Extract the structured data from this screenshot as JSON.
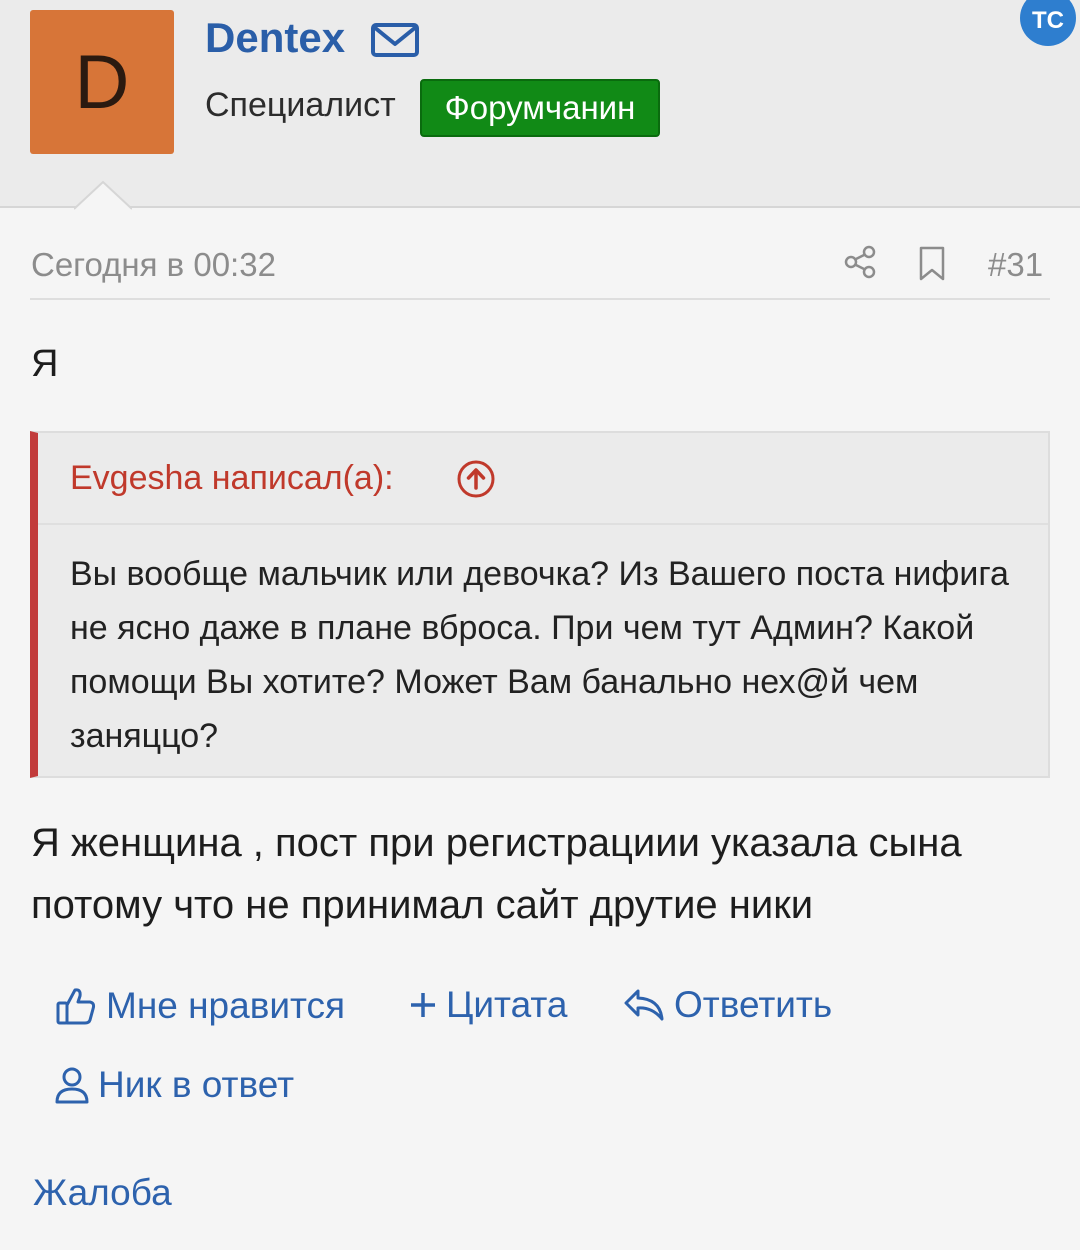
{
  "header": {
    "avatar_letter": "D",
    "username": "Dentex",
    "user_title": "Специалист",
    "badge": "Форумчанин",
    "tc_badge": "ТС",
    "avatar_color": "#d77538",
    "badge_color": "#118a16"
  },
  "meta": {
    "date": "Сегодня в 00:32",
    "post_number": "#31"
  },
  "post": {
    "first_line": "Я",
    "quote": {
      "author": "Evgesha написал(а):",
      "text": "Вы вообще мальчик или девочка? Из Вашего поста нифига не ясно даже в плане вброса. При чем тут Админ? Какой помощи Вы хотите? Может Вам банально нех@й чем заняццо?"
    },
    "reply": "Я женщина , пост при регистрациии указала сына потому что не принимал сайт друтие ники"
  },
  "actions": {
    "like": "Мне нравится",
    "quote": "Цитата",
    "reply": "Ответить",
    "nick": "Ник в ответ",
    "report": "Жалоба"
  },
  "colors": {
    "link": "#2d62ad",
    "quote_border": "#c23b3b",
    "quote_author": "#c0392b"
  }
}
